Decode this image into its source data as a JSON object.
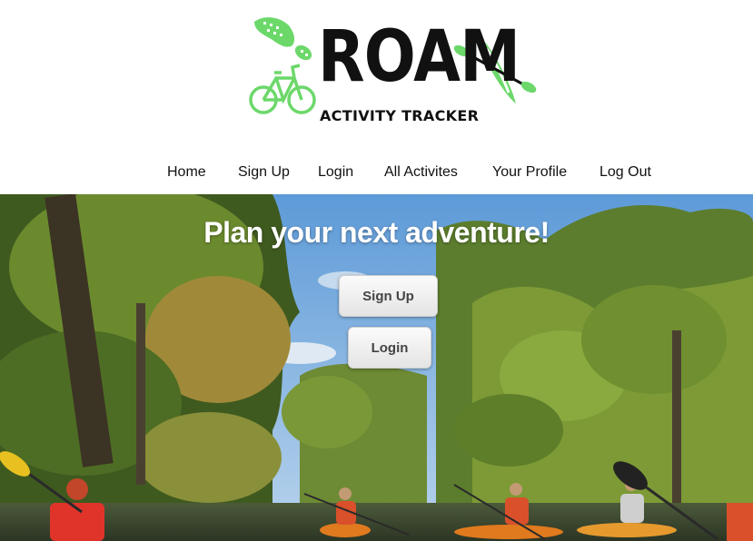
{
  "brand": {
    "name": "ROAM",
    "tagline": "ACTIVITY TRACKER",
    "accent_color": "#6cd86a",
    "logo_icons": [
      "shoe-print-icon",
      "bicycle-icon",
      "kayak-paddle-icon"
    ]
  },
  "nav": {
    "items": [
      {
        "label": "Home"
      },
      {
        "label": "Sign Up"
      },
      {
        "label": "Login"
      },
      {
        "label": "All Activites"
      },
      {
        "label": "Your Profile"
      },
      {
        "label": "Log Out"
      }
    ]
  },
  "hero": {
    "title": "Plan your next adventure!",
    "signup_label": "Sign Up",
    "login_label": "Login"
  }
}
